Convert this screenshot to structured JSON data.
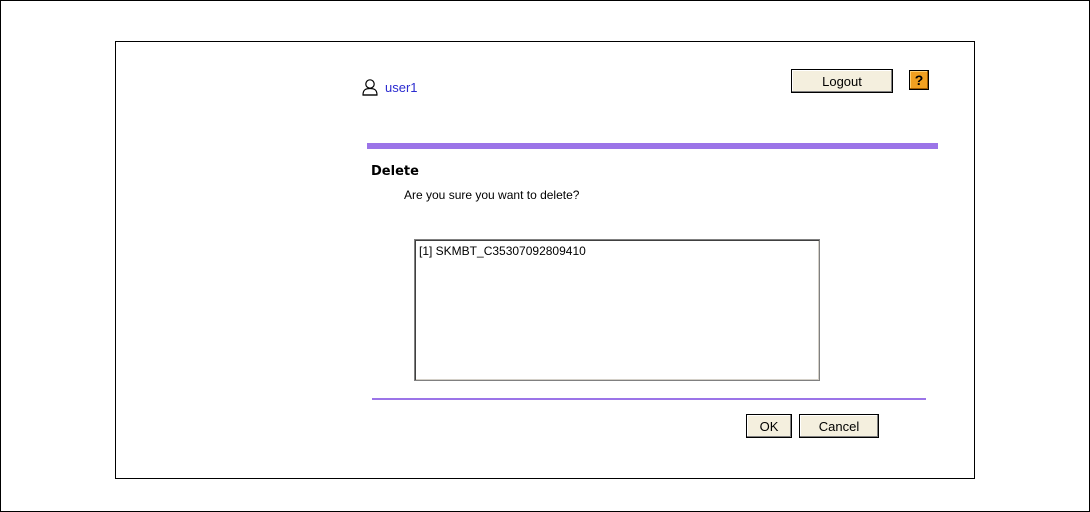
{
  "header": {
    "user_name": "user1",
    "user_icon": "user-icon",
    "logout_label": "Logout",
    "help_label": "?"
  },
  "dialog": {
    "title": "Delete",
    "message": "Are you sure you want to delete?",
    "items": [
      "[1] SKMBT_C35307092809410"
    ],
    "ok_label": "OK",
    "cancel_label": "Cancel"
  },
  "colors": {
    "accent_rule": "#9b74e8",
    "help_button": "#f1a020",
    "button_face": "#f4efde",
    "user_link": "#2b2bd0"
  }
}
